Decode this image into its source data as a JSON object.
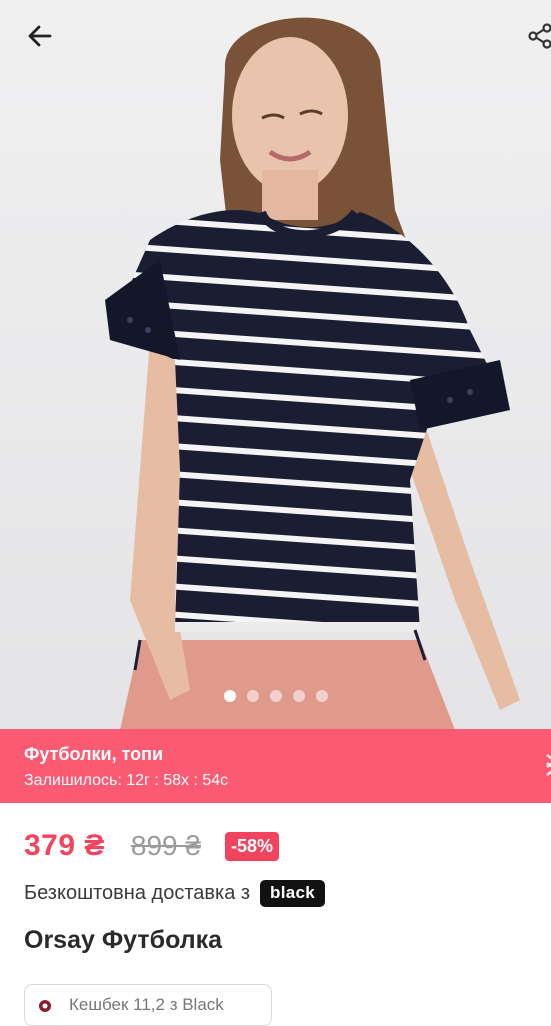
{
  "nav": {
    "back_icon": "arrow-left-icon",
    "share_icon": "share-icon"
  },
  "gallery": {
    "image_count": 5,
    "active_index": 0
  },
  "banner": {
    "category": "Футболки, топи",
    "remaining": "Залишилось:  12г : 58х : 54с",
    "background": "#fb5b72"
  },
  "price": {
    "current": "379 ₴",
    "old": "899 ₴",
    "discount": "-58%",
    "accent": "#f2445e"
  },
  "delivery": {
    "text": "Безкоштовна доставка з",
    "badge": "black"
  },
  "product": {
    "title": "Orsay Футболка"
  },
  "chip": {
    "text": "Кешбек 11,2 з Black"
  }
}
